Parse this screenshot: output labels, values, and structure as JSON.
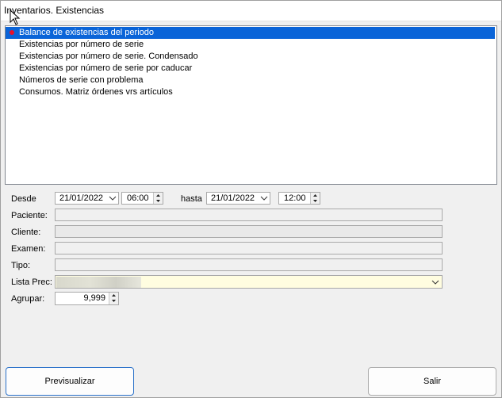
{
  "window": {
    "title": "Inventarios. Existencias"
  },
  "reports": {
    "items": [
      {
        "label": "Balance de existencias del periodo",
        "selected": true
      },
      {
        "label": "Existencias por número de serie"
      },
      {
        "label": "Existencias por número de serie. Condensado"
      },
      {
        "label": "Existencias por número de serie por caducar"
      },
      {
        "label": "Números de serie con problema"
      },
      {
        "label": "Consumos. Matriz órdenes vrs artículos"
      }
    ]
  },
  "filters": {
    "desde_label": "Desde",
    "desde_date": "21/01/2022",
    "desde_time": "06:00",
    "hasta_label": "hasta",
    "hasta_date": "21/01/2022",
    "hasta_time": "12:00",
    "paciente_label": "Paciente:",
    "cliente_label": "Cliente:",
    "examen_label": "Examen:",
    "tipo_label": "Tipo:",
    "lista_label": "Lista Prec:",
    "agrupar_label": "Agrupar:",
    "agrupar_value": "9,999"
  },
  "buttons": {
    "preview": "Previsualizar",
    "exit": "Salir"
  },
  "colors": {
    "selection": "#0a64d8",
    "lista_field": "#fffde0",
    "primary_border": "#2a71c9"
  }
}
